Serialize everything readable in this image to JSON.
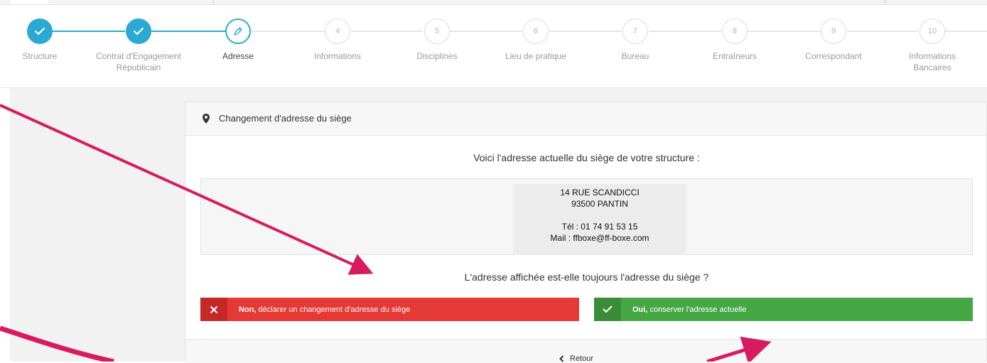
{
  "stepper": {
    "steps": [
      {
        "num": "",
        "label": "Structure",
        "state": "done"
      },
      {
        "num": "",
        "label": "Contrat d'Engagement Républicain",
        "state": "done"
      },
      {
        "num": "",
        "label": "Adresse",
        "state": "active"
      },
      {
        "num": "4",
        "label": "Informations",
        "state": "todo"
      },
      {
        "num": "5",
        "label": "Disciplines",
        "state": "todo"
      },
      {
        "num": "6",
        "label": "Lieu de pratique",
        "state": "todo"
      },
      {
        "num": "7",
        "label": "Bureau",
        "state": "todo"
      },
      {
        "num": "8",
        "label": "Entraîneurs",
        "state": "todo"
      },
      {
        "num": "9",
        "label": "Correspondant",
        "state": "todo"
      },
      {
        "num": "10",
        "label": "Informations Bancaires",
        "state": "todo"
      }
    ],
    "step2_line1": "Contrat d'Engagement",
    "step2_line2": "Républicain",
    "step10_line1": "Informations",
    "step10_line2": "Bancaires"
  },
  "card": {
    "title": "Changement d'adresse du siège",
    "intro": "Voici l'adresse actuelle du siège de votre structure :",
    "address": {
      "street": "14 RUE SCANDICCI",
      "city": "93500 PANTIN",
      "phone": "Tél : 01 74 91 53 15",
      "mail": "Mail : ffboxe@ff-boxe.com"
    },
    "question": "L'adresse affichée est-elle toujours l'adresse du siège ?",
    "btn_no_bold": "Non,",
    "btn_no_rest": " déclarer un changement d'adresse du siège",
    "btn_yes_bold": "Oui,",
    "btn_yes_rest": " conserver l'adresse actuelle",
    "back_label": "Retour"
  },
  "colors": {
    "accent": "#29a9d3",
    "no_button": "#e53935",
    "yes_button": "#45a845",
    "annotation": "#d81b60"
  }
}
